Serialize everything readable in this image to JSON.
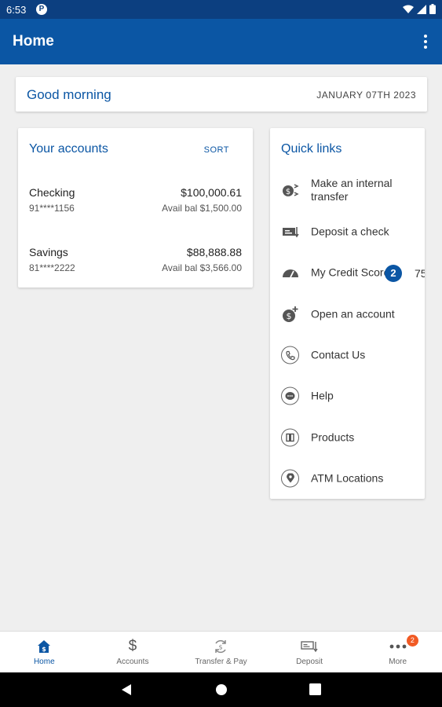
{
  "status_bar": {
    "time": "6:53",
    "notification_letter": "P"
  },
  "app_bar": {
    "title": "Home"
  },
  "greeting": {
    "text": "Good morning",
    "date": "JANUARY 07TH 2023"
  },
  "accounts": {
    "title": "Your accounts",
    "sort_label": "SORT",
    "items": [
      {
        "name": "Checking",
        "number": "91****1156",
        "balance": "$100,000.61",
        "available": "Avail bal $1,500.00"
      },
      {
        "name": "Savings",
        "number": "81****2222",
        "balance": "$88,888.88",
        "available": "Avail bal $3,566.00"
      }
    ]
  },
  "quick_links": {
    "title": "Quick links",
    "items": [
      {
        "label": "Make an internal transfer",
        "icon": "internal-transfer-icon"
      },
      {
        "label": "Deposit a check",
        "icon": "check-deposit-icon"
      },
      {
        "label": "My Credit Score",
        "icon": "speedometer-icon",
        "badge": "2",
        "score": "75"
      },
      {
        "label": "Open an account",
        "icon": "new-account-icon"
      },
      {
        "label": "Contact Us",
        "icon": "phone-icon"
      },
      {
        "label": "Help",
        "icon": "chat-icon"
      },
      {
        "label": "Products",
        "icon": "products-icon"
      },
      {
        "label": "ATM Locations",
        "icon": "location-pin-icon"
      }
    ]
  },
  "bottom_nav": {
    "items": [
      {
        "label": "Home",
        "icon": "home-icon",
        "active": true
      },
      {
        "label": "Accounts",
        "icon": "dollar-icon"
      },
      {
        "label": "Transfer & Pay",
        "icon": "transfer-icon"
      },
      {
        "label": "Deposit",
        "icon": "deposit-icon"
      },
      {
        "label": "More",
        "icon": "more-dots-icon",
        "badge": "2"
      }
    ]
  },
  "colors": {
    "primary": "#0b56a4",
    "status_bar": "#0c3f80",
    "badge": "#f15a24",
    "background": "#efefef"
  }
}
